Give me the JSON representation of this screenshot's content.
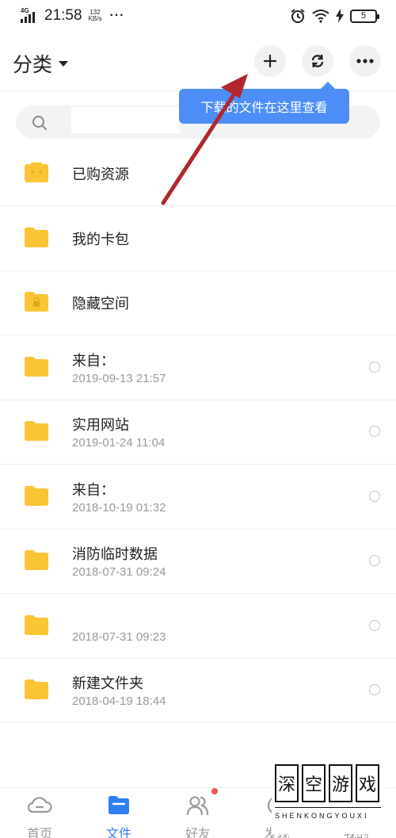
{
  "status_bar": {
    "network": "4G",
    "time": "21:58",
    "speed_value": "132",
    "speed_unit": "KB/s",
    "more": "···",
    "battery": "5"
  },
  "header": {
    "title": "分类"
  },
  "tooltip": {
    "text": "下载的文件在这里查看"
  },
  "search": {
    "value": ""
  },
  "files": [
    {
      "name": "已购资源",
      "date": "",
      "icon": "purchased-folder-icon",
      "selectable": false
    },
    {
      "name": "我的卡包",
      "date": "",
      "icon": "folder-icon",
      "selectable": false
    },
    {
      "name": "隐藏空间",
      "date": "",
      "icon": "locked-folder-icon",
      "selectable": false
    },
    {
      "name": "来自：",
      "date": "2019-09-13  21:57",
      "icon": "folder-icon",
      "selectable": true
    },
    {
      "name": "实用网站",
      "date": "2019-01-24  11:04",
      "icon": "folder-icon",
      "selectable": true
    },
    {
      "name": "来自：",
      "date": "2018-10-19  01:32",
      "icon": "folder-icon",
      "selectable": true
    },
    {
      "name": "消防临时数据",
      "date": "2018-07-31  09:24",
      "icon": "folder-icon",
      "selectable": true
    },
    {
      "name": "",
      "date": "2018-07-31  09:23",
      "icon": "folder-icon",
      "selectable": true
    },
    {
      "name": "新建文件夹",
      "date": "2018-04-19  18:44",
      "icon": "folder-icon",
      "selectable": true
    }
  ],
  "bottom_nav": [
    {
      "label": "首页",
      "icon": "home-cloud-icon",
      "active": false
    },
    {
      "label": "文件",
      "icon": "file-folder-icon",
      "active": true
    },
    {
      "label": "好友",
      "icon": "friends-icon",
      "active": false
    },
    {
      "label": "发现",
      "icon": "discover-icon",
      "active": false
    },
    {
      "label": "我的",
      "icon": "profile-icon",
      "active": false
    }
  ],
  "watermark": {
    "chars": [
      "深",
      "空",
      "游",
      "戏"
    ],
    "pinyin": "SHENKONGYOUXI"
  },
  "colors": {
    "accent": "#2f7ff0",
    "tooltip": "#4c8ef5",
    "folder": "#f9c535",
    "arrow": "#b1272d"
  }
}
